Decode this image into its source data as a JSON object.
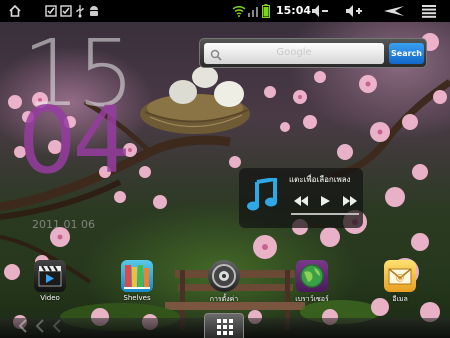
{
  "status_bar": {
    "time": "15:04",
    "icons": [
      "home-icon",
      "checkbox-icon",
      "checkbox-icon",
      "usb-icon",
      "android-icon",
      "wifi-icon",
      "signal-icon",
      "battery-icon",
      "volume-down-icon",
      "volume-up-icon",
      "back-icon",
      "menu-icon"
    ]
  },
  "clock": {
    "hour": "15",
    "minute": "04",
    "date": "2011 01 06"
  },
  "search": {
    "placeholder": "Google",
    "button_label": "Search"
  },
  "music": {
    "title": "แตะเพื่อเลือกเพลง",
    "prev_icon": "rewind-icon",
    "play_icon": "play-icon",
    "next_icon": "fast-forward-icon"
  },
  "dock": {
    "apps": [
      {
        "label": "Video",
        "icon": "video-clapper-icon"
      },
      {
        "label": "Shelves",
        "icon": "bookshelf-icon"
      },
      {
        "label": "การตั้งค่า",
        "icon": "settings-icon"
      },
      {
        "label": "เบราว์เซอร์",
        "icon": "globe-browser-icon"
      },
      {
        "label": "อีเมล",
        "icon": "email-icon"
      }
    ]
  },
  "bottom_bar": {
    "apps_button_icon": "app-grid-icon"
  }
}
